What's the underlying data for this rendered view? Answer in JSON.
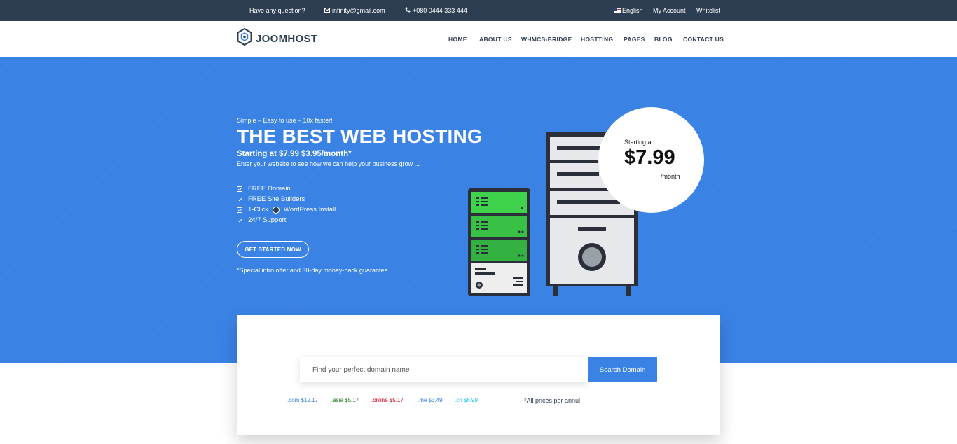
{
  "topbar": {
    "question": "Have any question?",
    "email": "infinity@gmail.com",
    "phone": "+080 0444 333 444",
    "language": "English",
    "account": "My Account",
    "whitelist": "Whitelist"
  },
  "nav": {
    "logo": "JOOMHOST",
    "items": [
      "HOME",
      "ABOUT US",
      "WHMCS-BRIDGE",
      "HOSTTING",
      "PAGES",
      "BLOG",
      "CONTACT US"
    ]
  },
  "hero": {
    "tagline": "Simple – Easy to use – 10x faster!",
    "headline": "THE BEST WEB HOSTING",
    "subhead": "Starting at $7.99 $3.95/month*",
    "intro": "Enter your website to see how we can help your business grow ...",
    "features": [
      "FREE Domain",
      "FREE Site Builders",
      "1-Click",
      "WordPress Install",
      "24/7 Support"
    ],
    "cta": "GET STARTED NOW",
    "guarantee": "*Special intro offer and 30-day money-back guarantee",
    "price_badge": {
      "label": "Starting at",
      "amount": "$7.99",
      "period": "/month"
    }
  },
  "search": {
    "placeholder": "Find your perfect domain name",
    "button": "Search Domain",
    "tlds": [
      {
        "text": ".com $12.17",
        "color": "#3a82e4"
      },
      {
        "text": ".asia $5.17",
        "color": "#1e7e1e"
      },
      {
        "text": ".online $5.17",
        "color": "#d0021b"
      },
      {
        "text": ".me $3.49",
        "color": "#3a82e4"
      },
      {
        "text": ".cn $6.99",
        "color": "#22c3e6"
      }
    ],
    "note": "*All prices per annul"
  },
  "colors": {
    "topbar": "#2e3e52",
    "hero": "#3a82e4",
    "accent": "#3a82e4",
    "server_green": "#3fd24b"
  },
  "icons": [
    "envelope-icon",
    "phone-icon",
    "us-flag-icon",
    "logo-hexagon-icon",
    "checkbox-icon",
    "wordpress-icon",
    "server-illustration"
  ]
}
